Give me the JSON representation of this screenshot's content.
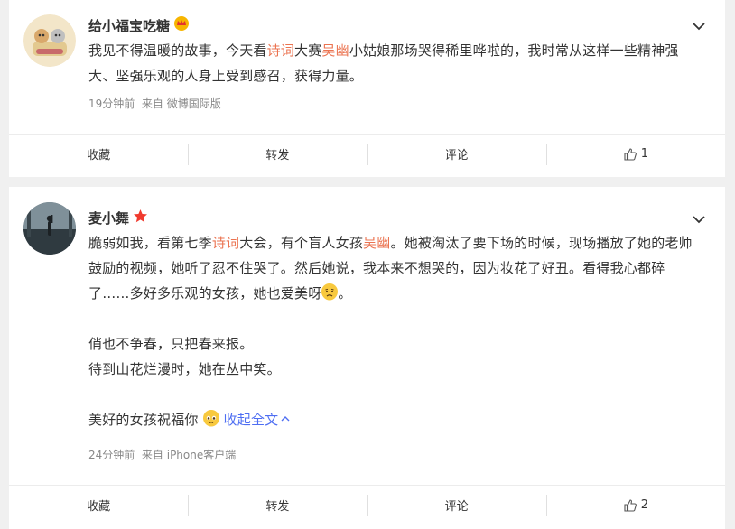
{
  "posts": [
    {
      "username": "给小福宝吃糖",
      "text_p1": "我见不得温暖的故事，今天看",
      "hl1": "诗词",
      "text_p2": "大赛",
      "hl2": "吴幽",
      "text_p3": "小姑娘那场哭得稀里哗啦的，我时常从这样一些精神强大、坚强乐观的人身上受到感召，获得力量。",
      "time": "19分钟前",
      "source": "来自 微博国际版",
      "actions": {
        "favorite": "收藏",
        "repost": "转发",
        "comment": "评论",
        "likes": "1"
      }
    },
    {
      "username": "麦小舞",
      "line1_a": "脆弱如我，看第七季",
      "hl1": "诗词",
      "line1_b": "大会，有个盲人女孩",
      "hl2": "吴幽",
      "line1_c": "。她被淘汰了要下场的时候，现场播放了她的老师鼓励的视频，她听了忍不住哭了。然后她说，我本来不想哭的，因为妆花了好丑。看得我心都碎了……多好多乐观的女孩，她也爱美呀",
      "line1_end": "。",
      "poem1": "俏也不争春，只把春来报。",
      "poem2": "待到山花烂漫时，她在丛中笑。",
      "closing": "美好的女孩祝福你",
      "collapse": "收起全文",
      "time": "24分钟前",
      "source": "来自 iPhone客户端",
      "actions": {
        "favorite": "收藏",
        "repost": "转发",
        "comment": "评论",
        "likes": "2"
      }
    }
  ],
  "icons": {
    "more": "chevron-down-icon",
    "like": "thumbs-up-icon",
    "vip_badge": "crown-badge-icon",
    "star_badge": "star-badge-icon",
    "emoji_sad": "sad-face-emoji",
    "emoji_pray": "pleading-face-emoji"
  },
  "colors": {
    "highlight": "#eb7350",
    "link_blue": "#4e6ef2",
    "meta_gray": "#888888"
  }
}
